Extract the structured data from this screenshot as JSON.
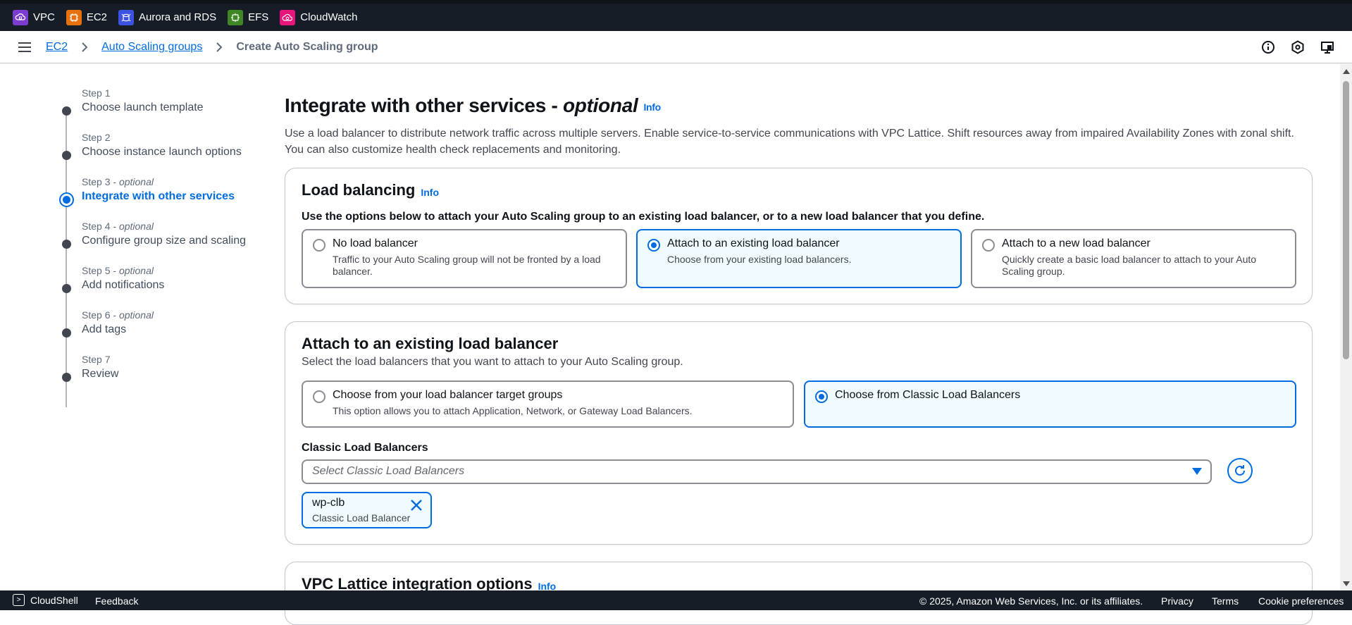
{
  "services": [
    {
      "label": "VPC",
      "icon": "vpc-icon",
      "color": "#7d3cd0"
    },
    {
      "label": "EC2",
      "icon": "ec2-icon",
      "color": "#e5710f"
    },
    {
      "label": "Aurora and RDS",
      "icon": "aurora-rds-icon",
      "color": "#3c52e0"
    },
    {
      "label": "EFS",
      "icon": "efs-icon",
      "color": "#3f8624"
    },
    {
      "label": "CloudWatch",
      "icon": "cloudwatch-icon",
      "color": "#e7157b"
    }
  ],
  "breadcrumb": {
    "items": [
      "EC2",
      "Auto Scaling groups"
    ],
    "current": "Create Auto Scaling group"
  },
  "steps": [
    {
      "num": "Step 1",
      "opt": "",
      "title": "Choose launch template",
      "state": "done"
    },
    {
      "num": "Step 2",
      "opt": "",
      "title": "Choose instance launch options",
      "state": "done"
    },
    {
      "num": "Step 3",
      "opt": "optional",
      "title": "Integrate with other services",
      "state": "active"
    },
    {
      "num": "Step 4",
      "opt": "optional",
      "title": "Configure group size and scaling",
      "state": "pending"
    },
    {
      "num": "Step 5",
      "opt": "optional",
      "title": "Add notifications",
      "state": "pending"
    },
    {
      "num": "Step 6",
      "opt": "optional",
      "title": "Add tags",
      "state": "pending"
    },
    {
      "num": "Step 7",
      "opt": "",
      "title": "Review",
      "state": "pending"
    }
  ],
  "page": {
    "title": "Integrate with other services -",
    "title_optional": "optional",
    "info": "Info",
    "description": "Use a load balancer to distribute network traffic across multiple servers. Enable service-to-service communications with VPC Lattice. Shift resources away from impaired Availability Zones with zonal shift. You can also customize health check replacements and monitoring."
  },
  "load_balancing": {
    "title": "Load balancing",
    "info": "Info",
    "instruction": "Use the options below to attach your Auto Scaling group to an existing load balancer, or to a new load balancer that you define.",
    "options": [
      {
        "label": "No load balancer",
        "desc": "Traffic to your Auto Scaling group will not be fronted by a load balancer.",
        "selected": false
      },
      {
        "label": "Attach to an existing load balancer",
        "desc": "Choose from your existing load balancers.",
        "selected": true
      },
      {
        "label": "Attach to a new load balancer",
        "desc": "Quickly create a basic load balancer to attach to your Auto Scaling group.",
        "selected": false
      }
    ]
  },
  "existing_lb": {
    "title": "Attach to an existing load balancer",
    "subtitle": "Select the load balancers that you want to attach to your Auto Scaling group.",
    "options": [
      {
        "label": "Choose from your load balancer target groups",
        "desc": "This option allows you to attach Application, Network, or Gateway Load Balancers.",
        "selected": false
      },
      {
        "label": "Choose from Classic Load Balancers",
        "desc": "",
        "selected": true
      }
    ],
    "field_label": "Classic Load Balancers",
    "placeholder": "Select Classic Load Balancers",
    "token": {
      "name": "wp-clb",
      "type": "Classic Load Balancer"
    }
  },
  "vpc_lattice": {
    "title": "VPC Lattice integration options",
    "info": "Info"
  },
  "footer": {
    "cloudshell": "CloudShell",
    "feedback": "Feedback",
    "copyright": "© 2025, Amazon Web Services, Inc. or its affiliates.",
    "privacy": "Privacy",
    "terms": "Terms",
    "cookies": "Cookie preferences"
  },
  "colors": {
    "accent": "#006ce0",
    "nav_dark": "#161d26",
    "selected_bg": "#f0fbff"
  }
}
